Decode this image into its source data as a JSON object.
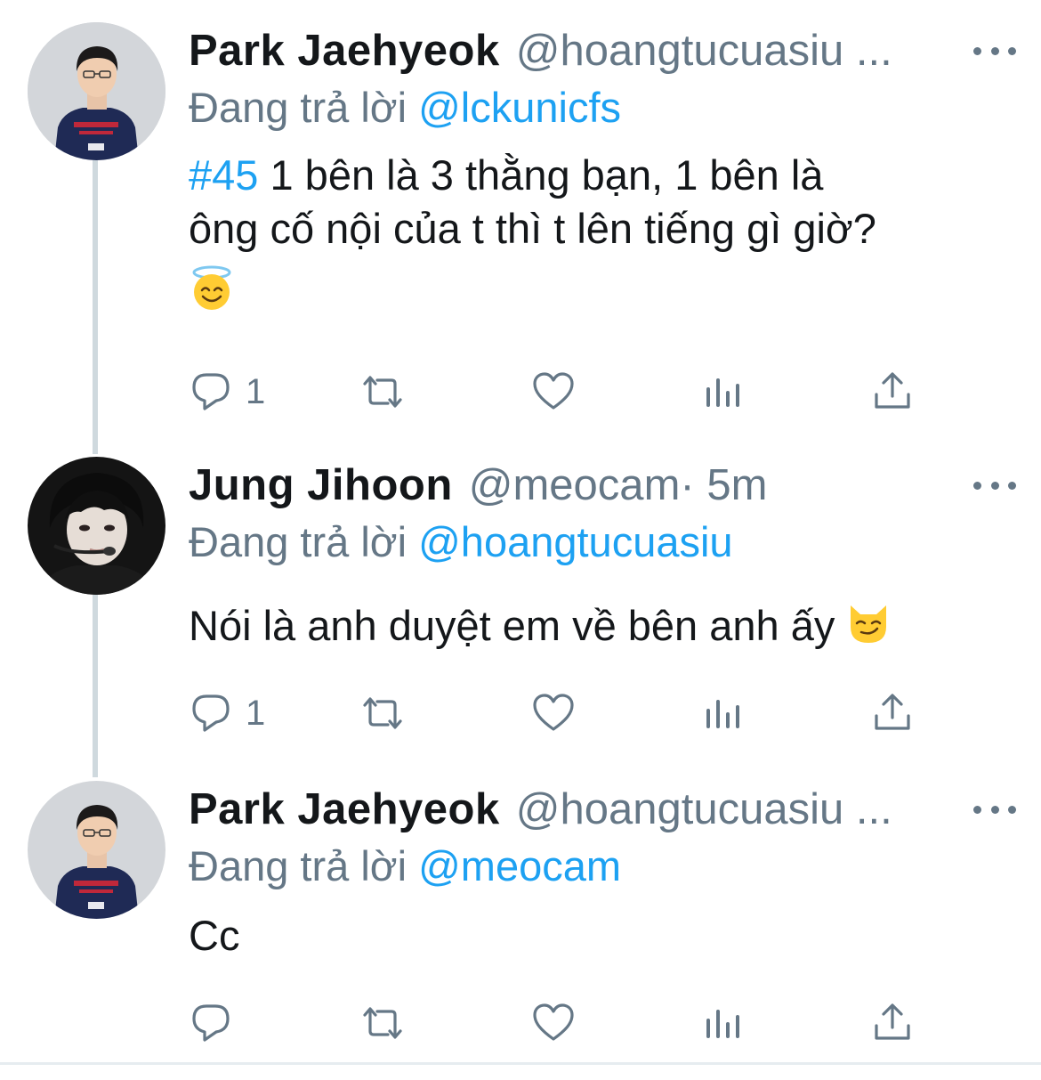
{
  "colors": {
    "accent": "#1da1f2",
    "muted": "#657786",
    "text": "#14171a",
    "thread_line": "#cfd9de"
  },
  "tweets": [
    {
      "name": "Park Jaehyeok",
      "handle": "@hoangtucuasiu ...",
      "time": "",
      "reply_prefix": "Đang trả lời ",
      "reply_to": "@lckunicfs",
      "hashtag": "#45",
      "text_line1": " 1 bên là 3 thằng bạn, 1 bên là",
      "text_line2": "ông cố nội của t thì t lên tiếng gì giờ?",
      "emoji": "smiling-face-with-halo",
      "reply_count": "1",
      "avatar": "avatar-park-jaehyeok"
    },
    {
      "name": "Jung Jihoon",
      "handle": "@meocam",
      "time": " · 5m",
      "reply_prefix": "Đang trả lời ",
      "reply_to": "@hoangtucuasiu",
      "text": "Nói là anh duyệt em về bên anh ấy ",
      "emoji": "smirking-cat-face",
      "reply_count": "1",
      "avatar": "avatar-jung-jihoon"
    },
    {
      "name": "Park Jaehyeok",
      "handle": "@hoangtucuasiu ...",
      "time": "",
      "reply_prefix": "Đang trả lời ",
      "reply_to": "@meocam",
      "text": "Cc",
      "reply_count": "",
      "avatar": "avatar-park-jaehyeok"
    }
  ],
  "action_icons": [
    "reply-icon",
    "retweet-icon",
    "like-icon",
    "analytics-icon",
    "share-icon"
  ]
}
